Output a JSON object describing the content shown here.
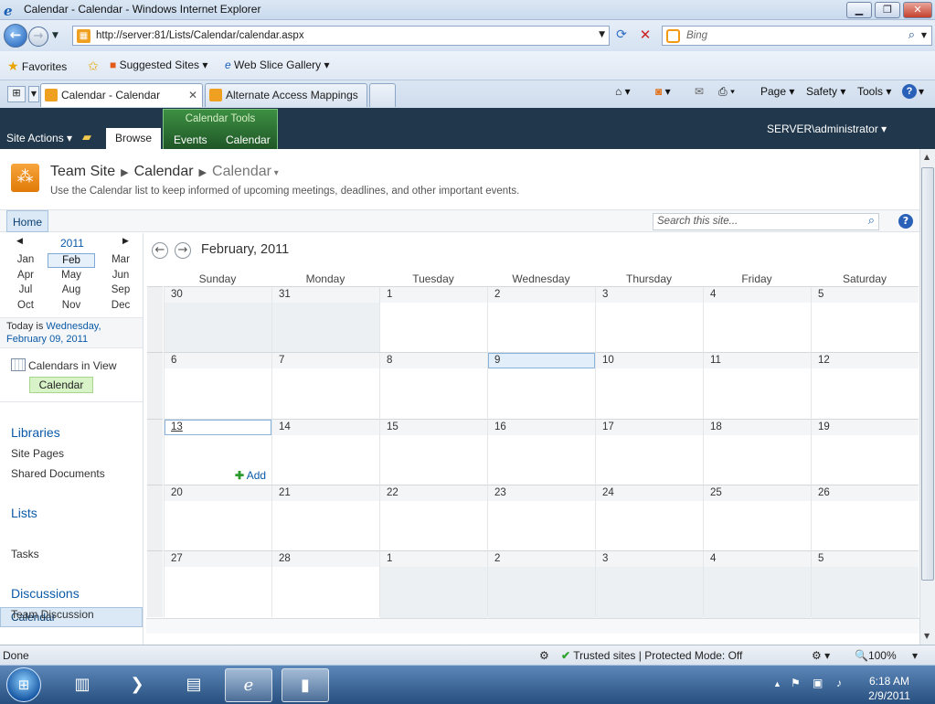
{
  "window": {
    "title": "Calendar - Calendar - Windows Internet Explorer",
    "min_glyph": "▁",
    "max_glyph": "❐",
    "close_glyph": "✕"
  },
  "address": {
    "url": "http://server:81/Lists/Calendar/calendar.aspx",
    "search_placeholder": "Bing"
  },
  "favorites": {
    "favorites": "Favorites",
    "suggested": "Suggested Sites",
    "webslice": "Web Slice Gallery"
  },
  "tabs": [
    {
      "label": "Calendar - Calendar"
    },
    {
      "label": "Alternate Access Mappings"
    }
  ],
  "commands": {
    "page": "Page",
    "safety": "Safety",
    "tools": "Tools"
  },
  "ribbon": {
    "site_actions": "Site Actions",
    "browse": "Browse",
    "group_title": "Calendar Tools",
    "events": "Events",
    "calendar": "Calendar",
    "user": "SERVER\\administrator"
  },
  "header": {
    "crumbs": [
      "Team Site",
      "Calendar",
      "Calendar"
    ],
    "description": "Use the Calendar list to keep informed of upcoming meetings, deadlines, and other important events."
  },
  "topnav": {
    "home": "Home",
    "search_placeholder": "Search this site..."
  },
  "datepicker": {
    "year": "2011",
    "months": [
      "Jan",
      "Feb",
      "Mar",
      "Apr",
      "May",
      "Jun",
      "Jul",
      "Aug",
      "Sep",
      "Oct",
      "Nov",
      "Dec"
    ],
    "selected": "Feb"
  },
  "today": {
    "prefix": "Today is",
    "date": "Wednesday, February 09, 2011"
  },
  "calendars_in_view": {
    "label": "Calendars in View",
    "chip": "Calendar"
  },
  "quicklaunch": {
    "libraries": "Libraries",
    "site_pages": "Site Pages",
    "shared_documents": "Shared Documents",
    "lists": "Lists",
    "calendar": "Calendar",
    "tasks": "Tasks",
    "discussions": "Discussions",
    "team_discussion": "Team Discussion"
  },
  "calendar": {
    "title": "February, 2011",
    "days": [
      "Sunday",
      "Monday",
      "Tuesday",
      "Wednesday",
      "Thursday",
      "Friday",
      "Saturday"
    ],
    "weeks": [
      [
        "30",
        "31",
        "1",
        "2",
        "3",
        "4",
        "5"
      ],
      [
        "6",
        "7",
        "8",
        "9",
        "10",
        "11",
        "12"
      ],
      [
        "13",
        "14",
        "15",
        "16",
        "17",
        "18",
        "19"
      ],
      [
        "20",
        "21",
        "22",
        "23",
        "24",
        "25",
        "26"
      ],
      [
        "27",
        "28",
        "1",
        "2",
        "3",
        "4",
        "5"
      ]
    ],
    "add_label": "Add"
  },
  "status": {
    "left": "Done",
    "zone": "Trusted sites | Protected Mode: Off",
    "zoom": "100%"
  },
  "taskbar": {
    "time": "6:18 AM",
    "date": "2/9/2011"
  }
}
